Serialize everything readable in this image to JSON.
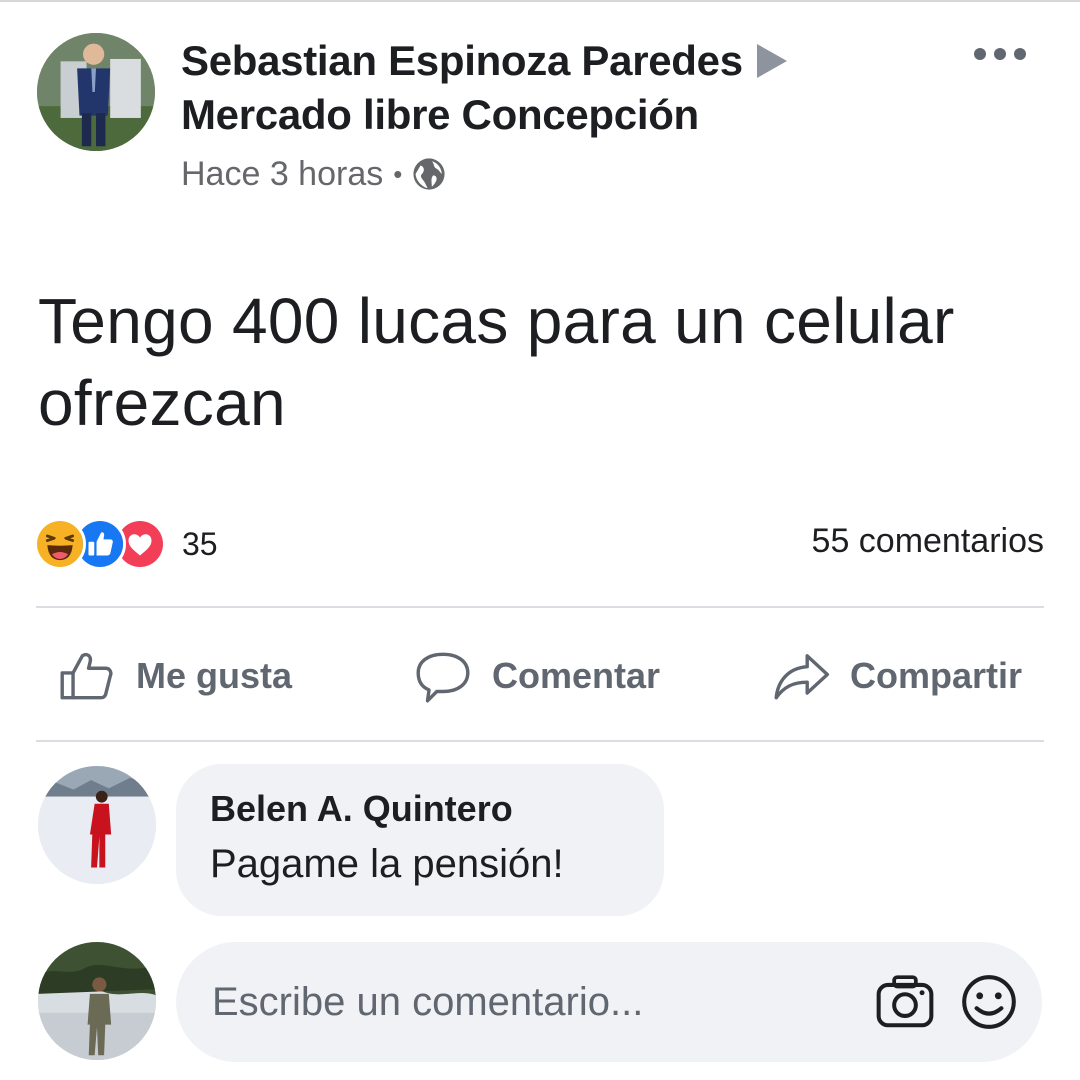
{
  "post": {
    "author": "Sebastian Espinoza Paredes",
    "group": "Mercado libre Concepción",
    "time": "Hace 3 horas",
    "separator": "•",
    "privacy_icon": "globe-icon",
    "text_line1": "Tengo 400 lucas para un celular",
    "text_line2": "ofrezcan"
  },
  "reactions": {
    "icons": [
      "haha-icon",
      "like-icon",
      "love-icon"
    ],
    "count": "35",
    "comments_label": "55 comentarios"
  },
  "actions": {
    "like_label": "Me gusta",
    "comment_label": "Comentar",
    "share_label": "Compartir"
  },
  "comment": {
    "author": "Belen A. Quintero",
    "text": "Pagame la pensión!"
  },
  "composer": {
    "placeholder": "Escribe un comentario...",
    "icons": [
      "camera-icon",
      "smiley-icon"
    ]
  },
  "colors": {
    "like_blue": "#1877f2",
    "love_red": "#f33e58",
    "haha_yellow": "#f7b125",
    "muted_text": "#65676b",
    "bubble_bg": "#f0f2f5"
  }
}
